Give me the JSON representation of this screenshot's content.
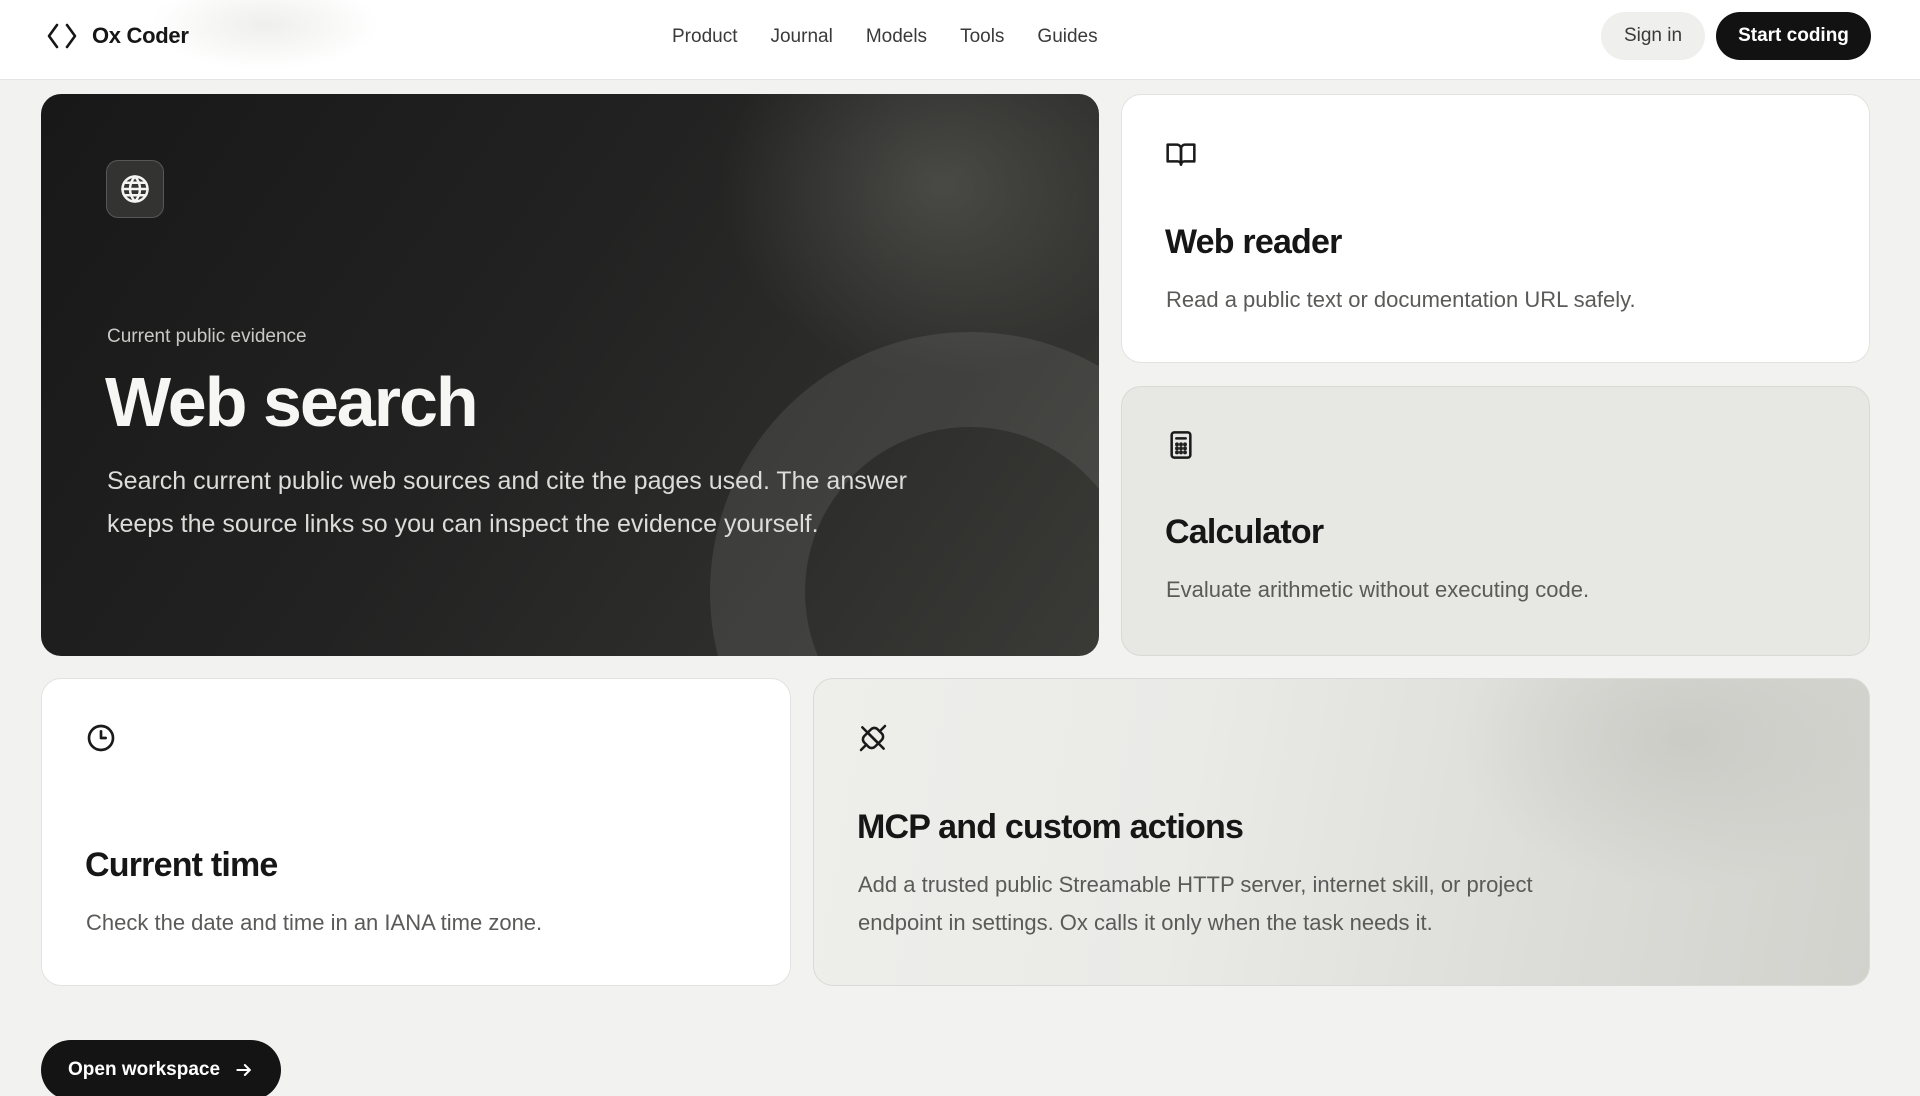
{
  "header": {
    "brand_name": "Ox Coder",
    "brand_icon": "code-brackets-icon",
    "nav": [
      "Product",
      "Journal",
      "Models",
      "Tools",
      "Guides"
    ],
    "sign_in_label": "Sign in",
    "start_coding_label": "Start coding"
  },
  "hero": {
    "icon": "globe-icon",
    "eyebrow": "Current public evidence",
    "title": "Web search",
    "description": "Search current public web sources and cite the pages used. The answer keeps the source links so you can inspect the evidence yourself."
  },
  "cards": {
    "reader": {
      "icon": "open-book-icon",
      "title": "Web reader",
      "description": "Read a public text or documentation URL safely."
    },
    "calculator": {
      "icon": "calculator-icon",
      "title": "Calculator",
      "description": "Evaluate arithmetic without executing code."
    },
    "time": {
      "icon": "clock-icon",
      "title": "Current time",
      "description": "Check the date and time in an IANA time zone."
    },
    "mcp": {
      "icon": "plug-disconnected-icon",
      "title": "MCP and custom actions",
      "description": "Add a trusted public Streamable HTTP server, internet skill, or project endpoint in settings. Ox calls it only when the task needs it."
    }
  },
  "footer": {
    "open_workspace_label": "Open workspace",
    "open_workspace_icon": "arrow-right-icon"
  },
  "colors": {
    "page_background": "#f2f2f0",
    "primary_dark": "#121212",
    "hero_background": "#1f1f1f"
  }
}
